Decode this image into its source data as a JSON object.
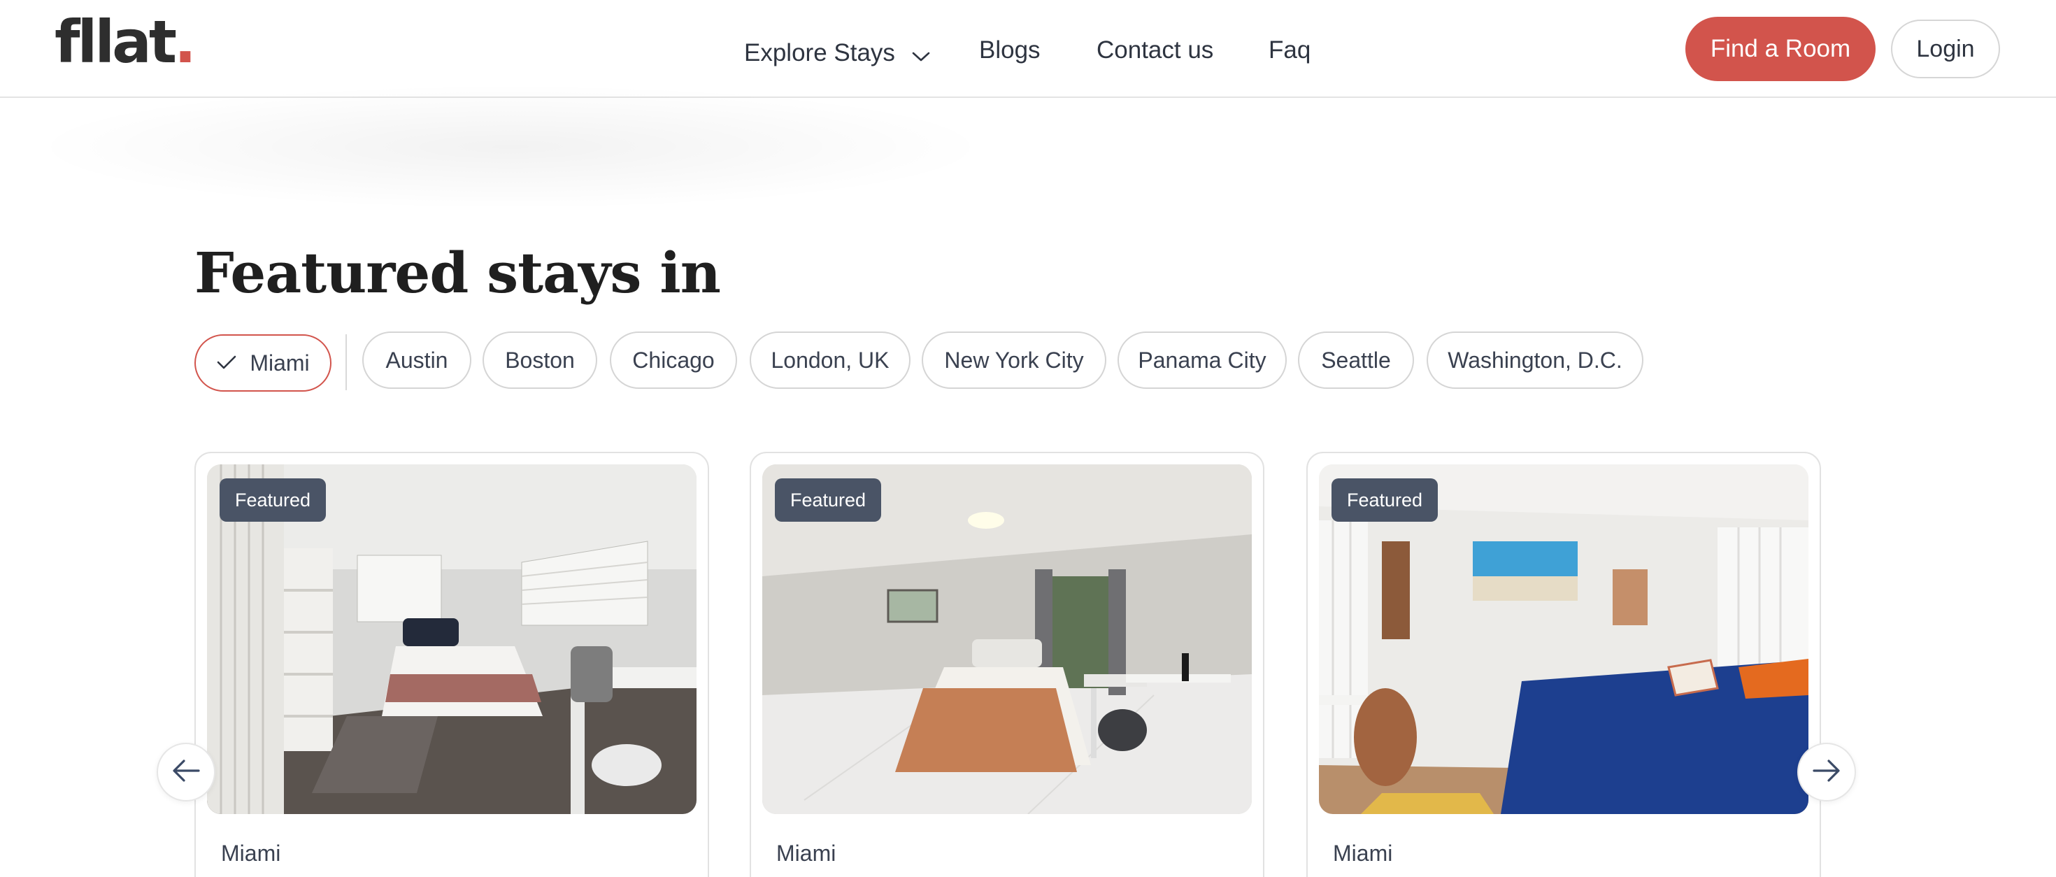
{
  "header": {
    "logo_text": "fllat",
    "logo_dot": ".",
    "nav": {
      "explore": "Explore Stays",
      "blogs": "Blogs",
      "contact": "Contact us",
      "faq": "Faq"
    },
    "find_room": "Find a Room",
    "login": "Login"
  },
  "section": {
    "title": "Featured stays in",
    "chips": [
      "Miami",
      "Austin",
      "Boston",
      "Chicago",
      "London, UK",
      "New York City",
      "Panama City",
      "Seattle",
      "Washington, D.C."
    ],
    "selected_chip": "Miami"
  },
  "cards": [
    {
      "badge": "Featured",
      "city": "Miami"
    },
    {
      "badge": "Featured",
      "city": "Miami"
    },
    {
      "badge": "Featured",
      "city": "Miami"
    }
  ],
  "colors": {
    "accent": "#d2544c",
    "badge_bg": "#4a5466"
  },
  "icons": {
    "explore_chevron": "chevron-down-icon",
    "chip_check": "check-icon",
    "prev": "arrow-left-icon",
    "next": "arrow-right-icon"
  }
}
